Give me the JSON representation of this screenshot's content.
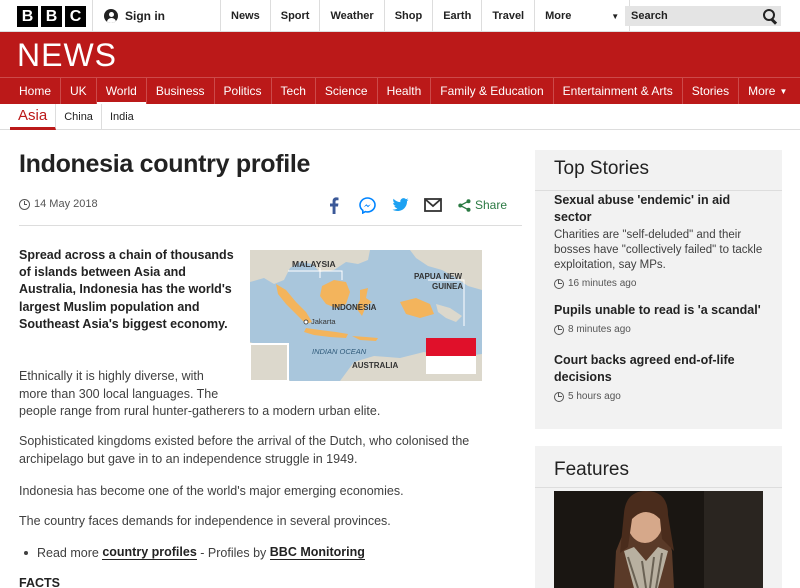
{
  "topbar": {
    "logo_letters": [
      "B",
      "B",
      "C"
    ],
    "signin_label": "Sign in",
    "nav": [
      "News",
      "Sport",
      "Weather",
      "Shop",
      "Earth",
      "Travel"
    ],
    "more_label": "More",
    "search_placeholder": "Search"
  },
  "newsbar": {
    "logo_text": "NEWS"
  },
  "sections": {
    "items": [
      "Home",
      "UK",
      "World",
      "Business",
      "Politics",
      "Tech",
      "Science",
      "Health",
      "Family & Education",
      "Entertainment & Arts",
      "Stories"
    ],
    "active": "World",
    "more_label": "More"
  },
  "subnav": {
    "current": "Asia",
    "items": [
      "China",
      "India"
    ]
  },
  "article": {
    "headline": "Indonesia country profile",
    "date": "14 May 2018",
    "share_label": "Share",
    "intro": "Spread across a chain of thousands of islands between Asia and Australia, Indonesia has the world's largest Muslim population and Southeast Asia's biggest economy.",
    "para1a": "Ethnically it is highly diverse, with more than 300 local languages. The",
    "para1b": "people range from rural hunter-gatherers to a modern urban elite.",
    "para2": "Sophisticated kingdoms existed before the arrival of the Dutch, who colonised the archipelago but gave in to an independence struggle in 1949.",
    "para3": "Indonesia has become one of the world's major emerging economies.",
    "para4": "The country faces demands for independence in several provinces.",
    "readmore_prefix": "Read more",
    "readmore_link": "country profiles",
    "readmore_mid": "- Profiles by",
    "readmore_source": "BBC Monitoring",
    "facts_heading": "FACTS",
    "map_labels": {
      "malaysia": "MALAYSIA",
      "papua": "PAPUA NEW",
      "guinea": "GUINEA",
      "indonesia": "INDONESIA",
      "jakarta": "Jakarta",
      "ocean": "INDIAN OCEAN",
      "australia": "AUSTRALIA"
    }
  },
  "top_stories": {
    "title": "Top Stories",
    "stories": [
      {
        "headline": "Sexual abuse 'endemic' in aid sector",
        "summary": "Charities are \"self-deluded\" and their bosses have \"collectively failed\" to tackle exploitation, say MPs.",
        "time": "16 minutes ago"
      },
      {
        "headline": "Pupils unable to read is 'a scandal'",
        "time": "8 minutes ago"
      },
      {
        "headline": "Court backs agreed end-of-life decisions",
        "time": "5 hours ago"
      }
    ]
  },
  "features": {
    "title": "Features"
  },
  "colors": {
    "brand_red": "#bb1919",
    "share_green": "#2b7a43",
    "facebook": "#3b5998",
    "twitter": "#1da1f2",
    "messenger": "#0084ff"
  }
}
